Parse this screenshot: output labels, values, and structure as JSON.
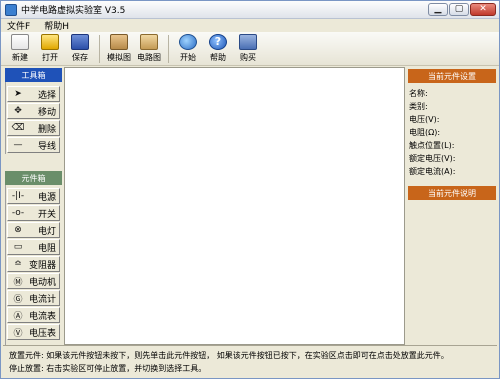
{
  "window": {
    "title": "中学电路虚拟实验室 V3.5",
    "min_label": "▁",
    "max_label": "▢",
    "close_label": "✕"
  },
  "menu": {
    "file": "文件F",
    "help": "帮助H"
  },
  "toolbar": {
    "new": "新建",
    "open": "打开",
    "save": "保存",
    "sim_diagram": "模拟图",
    "circuit_diagram": "电路图",
    "start": "开始",
    "help": "帮助",
    "buy": "购买"
  },
  "toolbox": {
    "title": "工具箱",
    "items": [
      {
        "label": "选择",
        "icon": "arrow-icon"
      },
      {
        "label": "移动",
        "icon": "move-icon"
      },
      {
        "label": "删除",
        "icon": "eraser-icon"
      },
      {
        "label": "导线",
        "icon": "wire-icon"
      }
    ]
  },
  "components": {
    "title": "元件箱",
    "items": [
      {
        "label": "电源",
        "icon": "battery-icon"
      },
      {
        "label": "开关",
        "icon": "switch-icon"
      },
      {
        "label": "电灯",
        "icon": "lamp-icon"
      },
      {
        "label": "电阻",
        "icon": "resistor-icon"
      },
      {
        "label": "变阻器",
        "icon": "rheostat-icon"
      },
      {
        "label": "电动机",
        "icon": "motor-icon"
      },
      {
        "label": "电流计",
        "icon": "galvanometer-icon"
      },
      {
        "label": "电流表",
        "icon": "ammeter-icon"
      },
      {
        "label": "电压表",
        "icon": "voltmeter-icon"
      }
    ],
    "glyphs": [
      "-|I-",
      "-o-",
      "⊗",
      "▭",
      "≏",
      "Ⓜ",
      "Ⓖ",
      "Ⓐ",
      "Ⓥ"
    ]
  },
  "right_panel": {
    "current_settings_title": "当前元件设置",
    "props": [
      "名称:",
      "类别:",
      "电压(V):",
      "电阻(Ω):",
      "触点位置(L):",
      "额定电压(V):",
      "额定电流(A):"
    ],
    "current_desc_title": "当前元件说明"
  },
  "status": {
    "line1": "放置元件: 如果该元件按钮未按下，则先单击此元件按钮， 如果该元件按钮已按下，在实验区点击即可在点击处放置此元件。",
    "line2": "停止放置: 右击实验区可停止放置，并切换到选择工具。"
  }
}
